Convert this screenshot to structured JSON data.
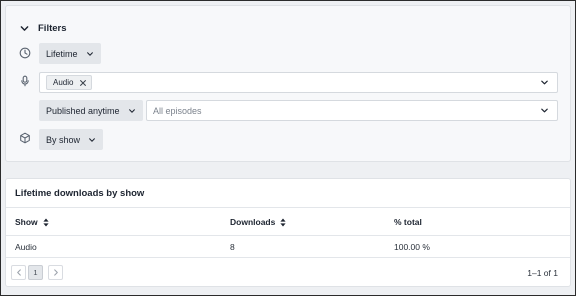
{
  "filters": {
    "title": "Filters",
    "time_range": {
      "label": "Lifetime"
    },
    "content_type": {
      "tags": [
        "Audio"
      ]
    },
    "published": {
      "label": "Published anytime"
    },
    "episodes": {
      "placeholder": "All episodes"
    },
    "group_by": {
      "label": "By show"
    }
  },
  "table": {
    "title": "Lifetime downloads by show",
    "columns": [
      "Show",
      "Downloads",
      "% total"
    ],
    "rows": [
      {
        "show": "Audio",
        "downloads": "8",
        "percent": "100.00 %"
      }
    ],
    "pagination": {
      "current_page": "1",
      "range_text": "1–1 of 1"
    }
  },
  "icons": {
    "collapse": "chevron-down-icon",
    "time": "clock-icon",
    "content_type": "microphone-icon",
    "group": "cube-icon"
  },
  "colors": {
    "panel_bg": "#f7f8fa",
    "dropdown_bg": "#e3e6ea",
    "border": "#dfe2e6"
  }
}
